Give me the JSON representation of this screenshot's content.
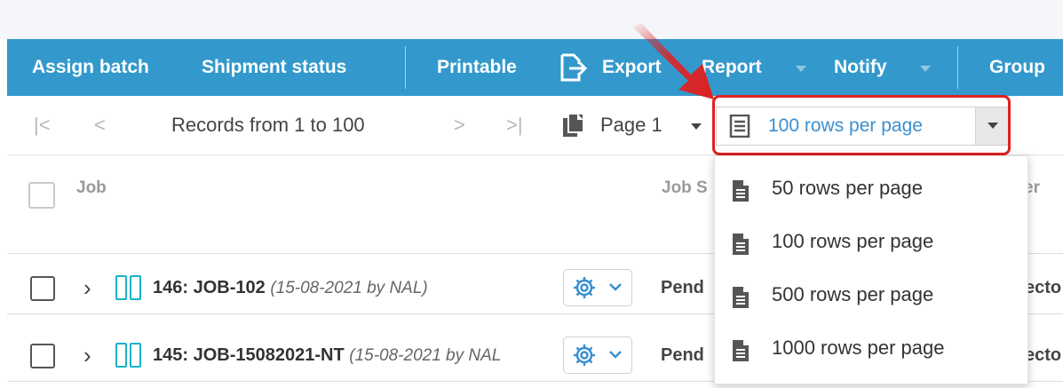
{
  "toolbar": {
    "assign_batch": "Assign batch",
    "shipment_status": "Shipment status",
    "printable": "Printable",
    "export": "Export",
    "report": "Report",
    "notify": "Notify",
    "group": "Group",
    "background_color": "#3399cc"
  },
  "pager": {
    "records": "Records from 1 to 100",
    "page": "Page 1",
    "rows_per_page": "100 rows per page",
    "accent_color": "#3a8fd0"
  },
  "table": {
    "columns": [
      "Job",
      "Job S",
      "er"
    ],
    "rows": [
      {
        "id": "146: JOB-102",
        "meta": "(15-08-2021 by NAL)",
        "status": "Pend",
        "extra": "ecto"
      },
      {
        "id": "145: JOB-15082021-NT",
        "meta": "(15-08-2021 by NAL",
        "status": "Pend",
        "extra": "ecto"
      }
    ],
    "icon_color": "#18b3c9"
  },
  "dropdown": {
    "options": [
      "50 rows per page",
      "100 rows per page",
      "500 rows per page",
      "1000 rows per page"
    ]
  },
  "highlight_color": "#e02020"
}
